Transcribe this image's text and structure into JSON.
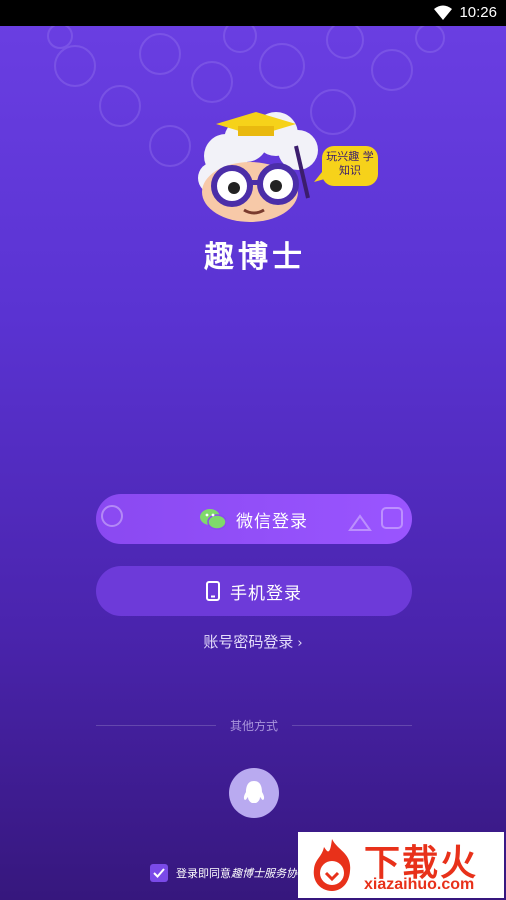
{
  "status_bar": {
    "time": "10:26"
  },
  "app": {
    "logo_text": "趣博士",
    "speech_bubble": "玩兴趣 学知识"
  },
  "login": {
    "wechat_label": "微信登录",
    "phone_label": "手机登录",
    "account_label": "账号密码登录",
    "other_methods": "其他方式",
    "agreement_prefix": "登录即同意",
    "agreement_link": "趣博士服务协议"
  },
  "watermark": {
    "title": "下载火",
    "url": "xiazaihuo.com"
  },
  "colors": {
    "background_top": "#6b3fe3",
    "background_bottom": "#36177d",
    "wechat_button": "#9a55ff",
    "phone_button": "#6d3ad9",
    "wechat_icon": "#7fd96b",
    "qq_button": "#b9aaf0",
    "mascot_hat": "#f6d21a",
    "watermark_red": "#e8311a"
  },
  "icons": {
    "wechat": "wechat-icon",
    "phone": "phone-icon",
    "qq": "qq-icon",
    "checkbox": "check-icon",
    "chevron": "chevron-right-icon"
  }
}
